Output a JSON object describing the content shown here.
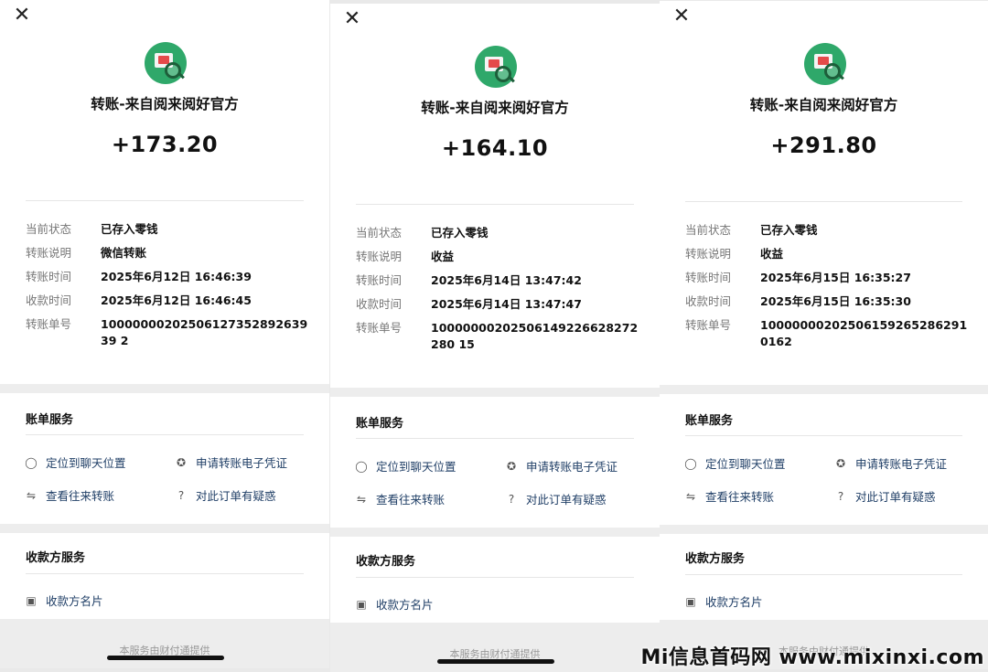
{
  "panels": [
    {
      "title": "转账-来自阅来阅好官方",
      "amount": "+173.20",
      "rows": [
        {
          "label": "当前状态",
          "value": "已存入零钱"
        },
        {
          "label": "转账说明",
          "value": "微信转账"
        },
        {
          "label": "转账时间",
          "value": "2025年6月12日 16:46:39"
        },
        {
          "label": "收款时间",
          "value": "2025年6月12日 16:46:45"
        },
        {
          "label": "转账单号",
          "value": "1000000020250612735289263939 2"
        }
      ]
    },
    {
      "title": "转账-来自阅来阅好官方",
      "amount": "+164.10",
      "rows": [
        {
          "label": "当前状态",
          "value": "已存入零钱"
        },
        {
          "label": "转账说明",
          "value": "收益"
        },
        {
          "label": "转账时间",
          "value": "2025年6月14日 13:47:42"
        },
        {
          "label": "收款时间",
          "value": "2025年6月14日 13:47:47"
        },
        {
          "label": "转账单号",
          "value": "10000000202506149226628272280 15"
        }
      ]
    },
    {
      "title": "转账-来自阅来阅好官方",
      "amount": "+291.80",
      "rows": [
        {
          "label": "当前状态",
          "value": "已存入零钱"
        },
        {
          "label": "转账说明",
          "value": "收益"
        },
        {
          "label": "转账时间",
          "value": "2025年6月15日 16:35:27"
        },
        {
          "label": "收款时间",
          "value": "2025年6月15日 16:35:30"
        },
        {
          "label": "转账单号",
          "value": "100000002025061592652862910162"
        }
      ]
    }
  ],
  "bill_service": {
    "title": "账单服务",
    "locate_chat": "定位到聊天位置",
    "apply_voucher": "申请转账电子凭证",
    "view_transfers": "查看往来转账",
    "question_order": "对此订单有疑惑"
  },
  "payee_service": {
    "title": "收款方服务",
    "payee_card": "收款方名片"
  },
  "footer_note": "本服务由财付通提供",
  "watermark": "Mi信息首码网 www.mixinxi.com",
  "icons": {
    "close": "close-icon",
    "chat": "chat-bubble-icon",
    "voucher": "voucher-icon",
    "transfer": "transfer-arrows-icon",
    "help": "help-icon",
    "card": "card-icon"
  },
  "colors": {
    "link": "#1f3e66",
    "logo": "#2fa86a",
    "background": "#ededed"
  }
}
